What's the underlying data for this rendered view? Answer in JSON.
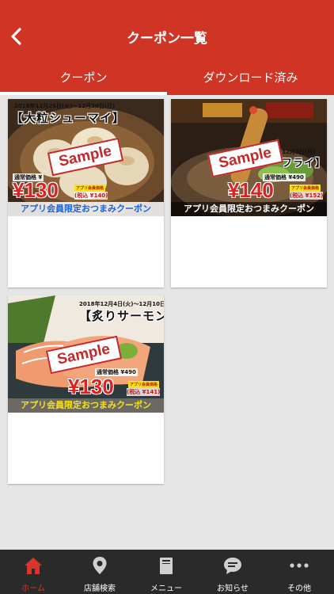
{
  "header": {
    "title": "クーポン一覧",
    "tabs": [
      {
        "label": "クーポン",
        "active": true
      },
      {
        "label": "ダウンロード済み",
        "active": false
      }
    ]
  },
  "coupons": [
    {
      "date": "2018年12月25日(火)～12月30日(日)",
      "title": "【大粒シューマイ】",
      "sample": "Sample",
      "regular": "通常価格 ¥",
      "price": "¥130",
      "member_tag": "アプリ会員価格",
      "tax": "(税込 ¥140)",
      "banner": "アプリ会員限定おつまみクーポン"
    },
    {
      "date": ")～12月3日(月)",
      "title": "フライ】",
      "sample": "Sample",
      "regular": "通常価格 ¥490",
      "price": "¥140",
      "member_tag": "アプリ会員価格",
      "tax": "(税込 ¥152)",
      "banner": "アプリ会員限定おつまみクーポン"
    },
    {
      "date": "2018年12月4日(火)～12月10日(月)",
      "title": "【炙りサーモン】",
      "sample": "Sample",
      "regular": "通常価格 ¥490",
      "price": "¥130",
      "member_tag": "アプリ会員価格",
      "tax": "(税込 ¥141)",
      "banner": "アプリ会員限定おつまみクーポン"
    }
  ],
  "tabbar": {
    "items": [
      {
        "label": "ホーム",
        "icon": "home-icon",
        "active": true
      },
      {
        "label": "店舗検索",
        "icon": "location-pin-icon",
        "active": false
      },
      {
        "label": "メニュー",
        "icon": "menu-book-icon",
        "active": false
      },
      {
        "label": "お知らせ",
        "icon": "chat-bubble-icon",
        "active": false
      },
      {
        "label": "その他",
        "icon": "more-dots-icon",
        "active": false
      }
    ]
  },
  "colors": {
    "header_red": "#cf3424",
    "active_tab_red": "#d9352a",
    "tabbar_dark": "#2a2a2a"
  }
}
